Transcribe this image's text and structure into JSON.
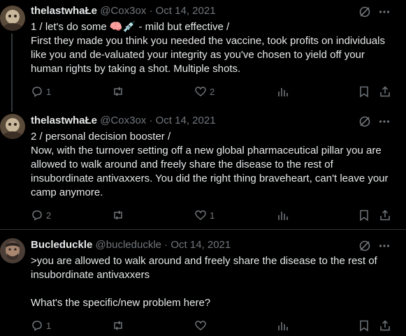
{
  "tweets": [
    {
      "display_name": "thelastwhaŁe",
      "handle": "@Cox3ox",
      "sep": "·",
      "date": "Oct 14, 2021",
      "text_line1_a": "1 / let's do some ",
      "text_line1_emoji": "🧠💉",
      "text_line1_b": " - mild but effective /",
      "text": "First they made you think you needed the vaccine, took profits on individuals like you and de-valuated your integrity as you've chosen to yield off your human rights by taking a shot. Multiple shots.",
      "replies": "1",
      "reposts": "",
      "likes": "2"
    },
    {
      "display_name": "thelastwhaŁe",
      "handle": "@Cox3ox",
      "sep": "·",
      "date": "Oct 14, 2021",
      "text": "2 / personal decision booster /\nNow, with the turnover setting off a new global pharmaceutical pillar you are allowed to walk around and freely share the disease to the rest of insubordinate antivaxxers. You did the right thing braveheart, can't leave your camp anymore.",
      "replies": "2",
      "reposts": "",
      "likes": "1"
    },
    {
      "display_name": "Bucleduckle",
      "handle": "@bucleduckle",
      "sep": "·",
      "date": "Oct 14, 2021",
      "text": ">you are allowed to walk around and freely share the disease to the rest of insubordinate antivaxxers\n\nWhat's the specific/new problem here?",
      "replies": "1",
      "reposts": "",
      "likes": ""
    }
  ],
  "colors": {
    "background": "#000000",
    "text": "#e7e9ea",
    "muted": "#71767b",
    "divider": "#2f3336"
  }
}
